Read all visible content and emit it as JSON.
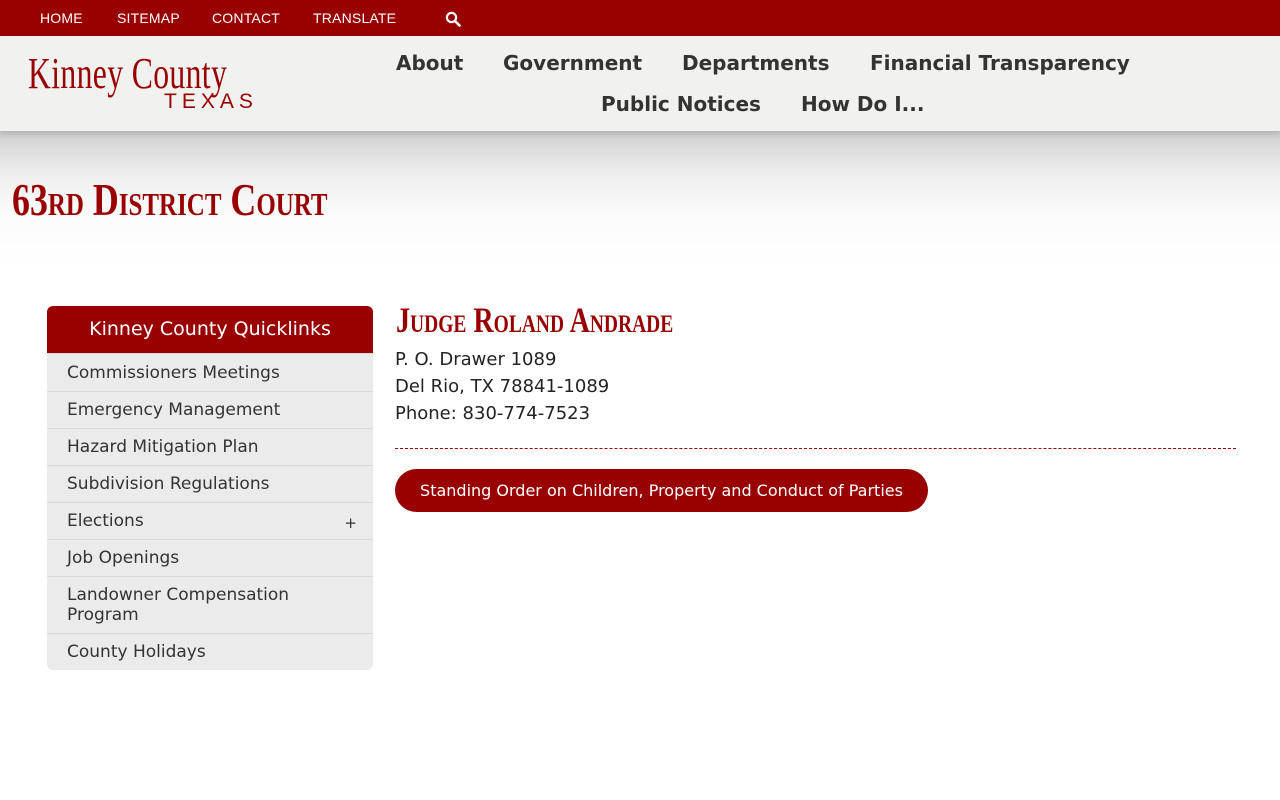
{
  "topbar": {
    "links": [
      "HOME",
      "SITEMAP",
      "CONTACT",
      "TRANSLATE"
    ],
    "search_icon": "search-icon"
  },
  "logo": {
    "line1": "Kinney County",
    "line2": "TEXAS"
  },
  "nav": {
    "items": [
      "About",
      "Government",
      "Departments",
      "Financial Transparency",
      "Public Notices",
      "How Do I..."
    ]
  },
  "page": {
    "title": "63rd District Court"
  },
  "sidebar": {
    "heading": "Kinney County Quicklinks",
    "items": [
      {
        "label": "Commissioners Meetings",
        "expand": ""
      },
      {
        "label": "Emergency Management",
        "expand": ""
      },
      {
        "label": "Hazard Mitigation Plan",
        "expand": ""
      },
      {
        "label": "Subdivision Regulations",
        "expand": ""
      },
      {
        "label": "Elections",
        "expand": "+"
      },
      {
        "label": "Job Openings",
        "expand": ""
      },
      {
        "label": "Landowner Compensation Program",
        "expand": ""
      },
      {
        "label": "County Holidays",
        "expand": ""
      }
    ]
  },
  "main": {
    "judge_name": "Judge Roland Andrade",
    "address_line1": "P. O. Drawer 1089",
    "address_line2": "Del Rio, TX 78841-1089",
    "phone": "Phone: 830-774-7523",
    "button_label": "Standing Order on Children, Property and Conduct of Parties"
  },
  "colors": {
    "brand": "#990000",
    "header_bg": "#f1f1ef",
    "sidebar_bg": "#ebebeb"
  }
}
